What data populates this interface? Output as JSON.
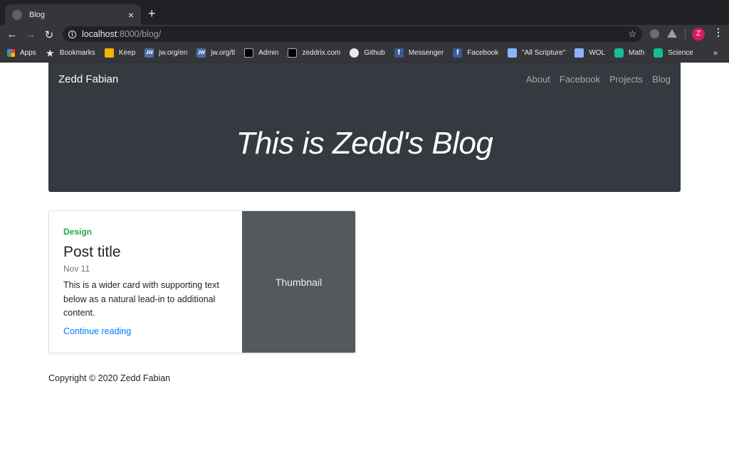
{
  "browser": {
    "tab_title": "Blog",
    "tab_close": "×",
    "new_tab": "+",
    "back": "←",
    "forward": "→",
    "reload": "↻",
    "url_host": "localhost",
    "url_rest": ":8000/blog/",
    "bookmark_star": "☆",
    "profile_initial": "Z",
    "menu": "⋮",
    "bookmarks": [
      {
        "label": "Apps",
        "icon": "apps-icon"
      },
      {
        "label": "Bookmarks",
        "icon": "star-icon"
      },
      {
        "label": "Keep",
        "icon": "keep-icon"
      },
      {
        "label": "jw.org/en",
        "icon": "jw-icon"
      },
      {
        "label": "jw.org/tl",
        "icon": "jw-icon"
      },
      {
        "label": "Admin",
        "icon": "admin-icon"
      },
      {
        "label": "zeddrix.com",
        "icon": "admin-icon"
      },
      {
        "label": "Github",
        "icon": "github-icon"
      },
      {
        "label": "Messenger",
        "icon": "facebook-icon"
      },
      {
        "label": "Facebook",
        "icon": "facebook-icon"
      },
      {
        "label": "\"All Scripture\"",
        "icon": "wol-icon"
      },
      {
        "label": "WOL",
        "icon": "wol-icon"
      },
      {
        "label": "Math",
        "icon": "khan-icon"
      },
      {
        "label": "Science",
        "icon": "khan-icon"
      }
    ],
    "bookmarks_overflow": "»"
  },
  "navbar": {
    "brand": "Zedd Fabian",
    "links": [
      "About",
      "Facebook",
      "Projects",
      "Blog"
    ]
  },
  "hero": {
    "title": "This is Zedd's Blog"
  },
  "post": {
    "category": "Design",
    "category_color": "#28a745",
    "title": "Post title",
    "date": "Nov 11",
    "excerpt": "This is a wider card with supporting text below as a natural lead-in to additional content.",
    "link_label": "Continue reading",
    "link_color": "#007bff",
    "thumbnail_label": "Thumbnail"
  },
  "footer": {
    "copyright": "Copyright © 2020 Zedd Fabian"
  }
}
